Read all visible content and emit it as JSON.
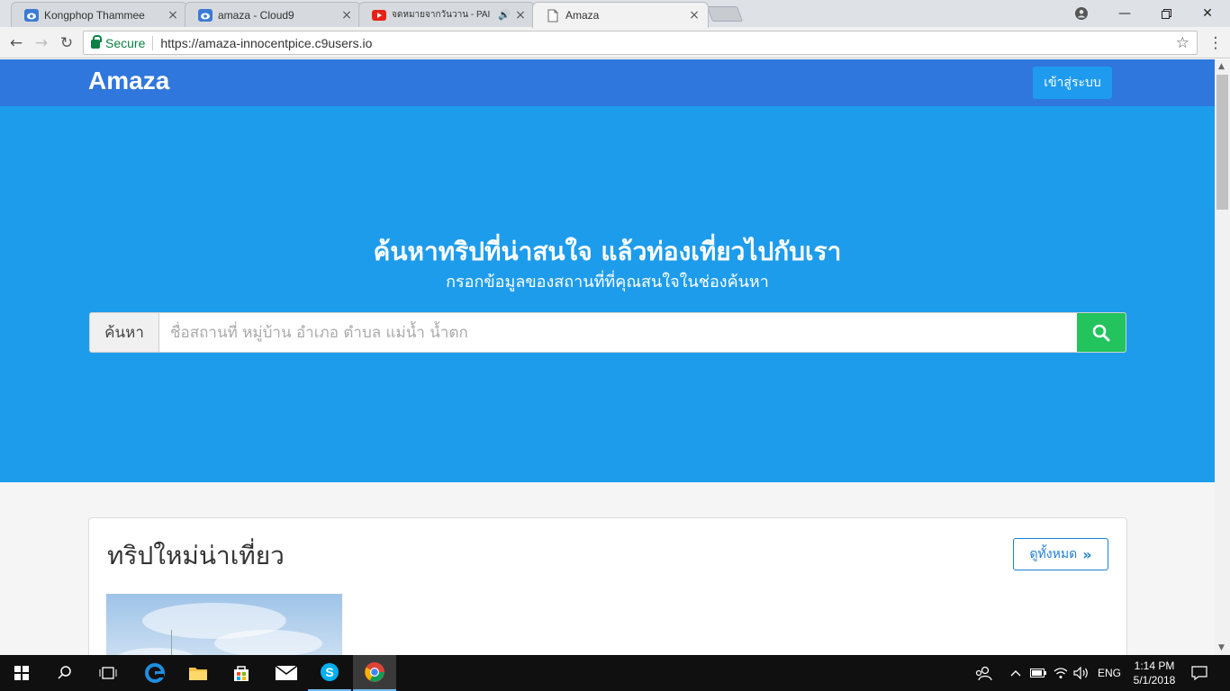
{
  "browser": {
    "tabs": [
      {
        "title": "Kongphop Thammee",
        "icon": "cloud9-icon",
        "active": false
      },
      {
        "title": "amaza - Cloud9",
        "icon": "cloud9-icon",
        "active": false
      },
      {
        "title": "จดหมายจากวันวาน - PAI",
        "icon": "youtube-icon",
        "active": false
      },
      {
        "title": "Amaza",
        "icon": "page-icon",
        "active": true
      }
    ],
    "secure_label": "Secure",
    "url": "https://amaza-innocentpice.c9users.io"
  },
  "site": {
    "brand": "Amaza",
    "login_label": "เข้าสู่ระบบ",
    "hero_title": "ค้นหาทริปที่น่าสนใจ แล้วท่องเที่ยวไปกับเรา",
    "hero_subtitle": "กรอกข้อมูลของสถานที่ที่คุณสนใจในช่องค้นหา",
    "search_addon": "ค้นหา",
    "search_placeholder": "ชื่อสถานที่ หมู่บ้าน อำเภอ ตำบล แม่น้ำ น้ำตก",
    "section_title": "ทริปใหม่น่าเที่ยว",
    "see_all_label": "ดูทั้งหมด"
  },
  "colors": {
    "nav": "#2f77dc",
    "hero": "#1e9cec",
    "search_button": "#23c45e",
    "accent": "#1e7fd6"
  },
  "taskbar": {
    "language": "ENG",
    "time": "1:14 PM",
    "date": "5/1/2018"
  }
}
